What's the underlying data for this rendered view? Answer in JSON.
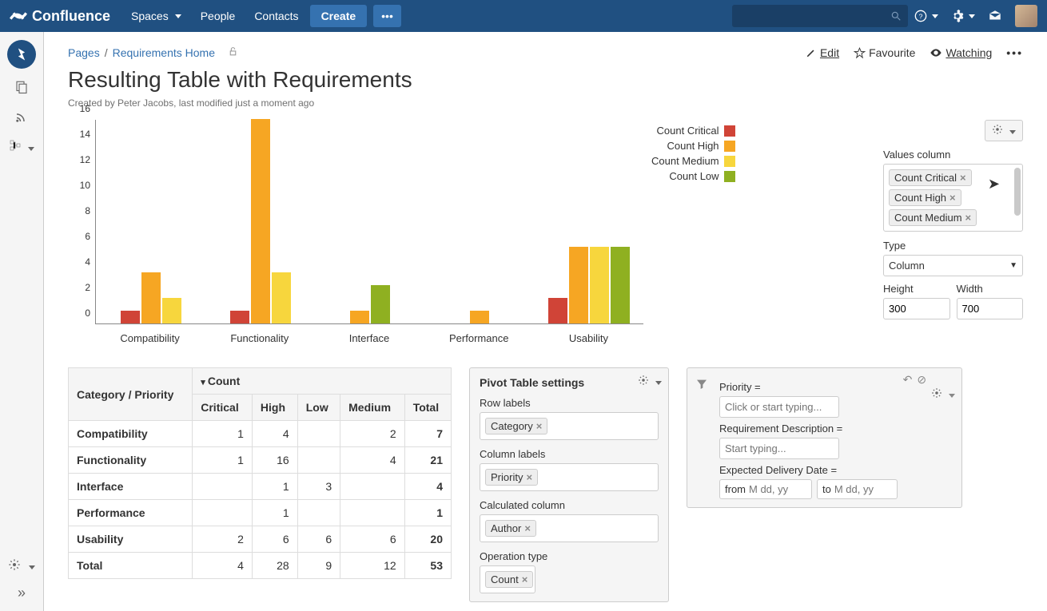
{
  "nav": {
    "product": "Confluence",
    "spaces": "Spaces",
    "people": "People",
    "contacts": "Contacts",
    "create": "Create"
  },
  "breadcrumb": {
    "pages": "Pages",
    "home": "Requirements Home"
  },
  "page": {
    "title": "Resulting Table with Requirements",
    "meta": "Created by Peter Jacobs, last modified just a moment ago",
    "edit": "Edit",
    "favourite": "Favourite",
    "watching": "Watching"
  },
  "chart_data": {
    "type": "bar",
    "categories": [
      "Compatibility",
      "Functionality",
      "Interface",
      "Performance",
      "Usability"
    ],
    "series": [
      {
        "name": "Count Critical",
        "color": "#d04437",
        "values": [
          1,
          1,
          0,
          0,
          2
        ]
      },
      {
        "name": "Count High",
        "color": "#f6a623",
        "values": [
          4,
          16,
          1,
          1,
          6
        ]
      },
      {
        "name": "Count Medium",
        "color": "#f7d63d",
        "values": [
          2,
          4,
          0,
          0,
          6
        ]
      },
      {
        "name": "Count Low",
        "color": "#8fb021",
        "values": [
          0,
          0,
          3,
          0,
          6
        ]
      }
    ],
    "ylim": [
      0,
      16
    ],
    "yticks": [
      0,
      2,
      4,
      6,
      8,
      10,
      12,
      14,
      16
    ]
  },
  "right": {
    "values_label": "Values column",
    "values": [
      "Count Critical",
      "Count High",
      "Count Medium"
    ],
    "type_label": "Type",
    "type_value": "Column",
    "height_label": "Height",
    "height_value": "300",
    "width_label": "Width",
    "width_value": "700"
  },
  "pivot_table": {
    "row_header": "Category / Priority",
    "count_header": "Count",
    "columns": [
      "Critical",
      "High",
      "Low",
      "Medium",
      "Total"
    ],
    "rows": [
      {
        "label": "Compatibility",
        "cells": [
          "1",
          "4",
          "",
          "2",
          "7"
        ]
      },
      {
        "label": "Functionality",
        "cells": [
          "1",
          "16",
          "",
          "4",
          "21"
        ]
      },
      {
        "label": "Interface",
        "cells": [
          "",
          "1",
          "3",
          "",
          "4"
        ]
      },
      {
        "label": "Performance",
        "cells": [
          "",
          "1",
          "",
          "",
          "1"
        ]
      },
      {
        "label": "Usability",
        "cells": [
          "2",
          "6",
          "6",
          "6",
          "20"
        ]
      },
      {
        "label": "Total",
        "cells": [
          "4",
          "28",
          "9",
          "12",
          "53"
        ]
      }
    ]
  },
  "settings": {
    "title": "Pivot Table settings",
    "row_labels": "Row labels",
    "row_value": "Category",
    "col_labels": "Column labels",
    "col_value": "Priority",
    "calc_label": "Calculated column",
    "calc_value": "Author",
    "op_label": "Operation type",
    "op_value": "Count"
  },
  "filter": {
    "priority_label": "Priority =",
    "priority_placeholder": "Click or start typing...",
    "desc_label": "Requirement Description =",
    "desc_placeholder": "Start typing...",
    "date_label": "Expected Delivery Date =",
    "from": "from",
    "to": "to",
    "date_placeholder": "M dd, yy"
  }
}
